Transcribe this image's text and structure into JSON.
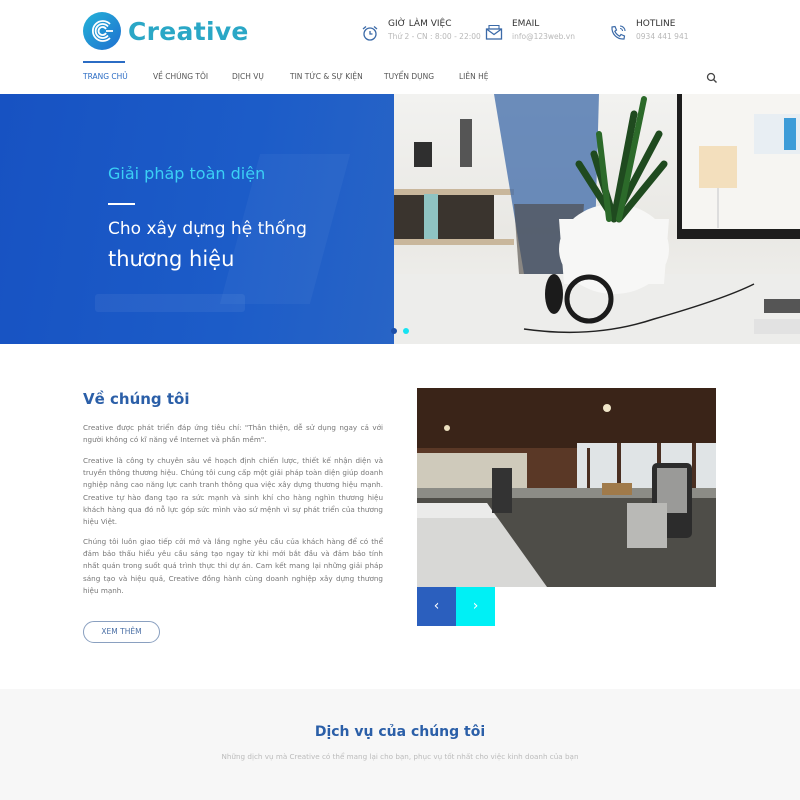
{
  "brand": {
    "name": "Creative",
    "colors": {
      "primary": "#1c5cc8",
      "accent": "#00f0f5",
      "title": "#2b5fa8",
      "logo": "#2aa7c6"
    }
  },
  "header": {
    "working_hours": {
      "icon": "alarm-clock-icon",
      "label": "GIỜ LÀM VIỆC",
      "value": "Thứ 2 - CN : 8:00 - 22:00"
    },
    "email": {
      "icon": "envelope-icon",
      "label": "EMAIL",
      "value": "info@123web.vn"
    },
    "hotline": {
      "icon": "phone-icon",
      "label": "HOTLINE",
      "value": "0934 441 941"
    }
  },
  "nav": {
    "items": [
      {
        "label": "Trang chủ",
        "active": true
      },
      {
        "label": "Về chúng tôi",
        "active": false
      },
      {
        "label": "Dịch vụ",
        "active": false
      },
      {
        "label": "Tin tức & sự kiện",
        "active": false
      },
      {
        "label": "Tuyển dụng",
        "active": false
      },
      {
        "label": "Liên hệ",
        "active": false
      }
    ],
    "search_icon": "search-icon"
  },
  "hero": {
    "subtitle": "Giải pháp toàn diện",
    "line1": "Cho xây dựng hệ thống",
    "line2": "thương hiệu",
    "slides_total": 2,
    "active_slide": 2
  },
  "about": {
    "title": "Về chúng tôi",
    "paragraphs": [
      "Creative được phát triển đáp ứng tiêu chí: \"Thân thiện, dễ sử dụng ngay cả với người không có kĩ năng về Internet và phần mềm\".",
      "Creative là công ty chuyên sâu về hoạch định chiến lược, thiết kế nhận diện và truyền thông thương hiệu. Chúng tôi cung cấp một giải pháp toàn diện giúp doanh nghiệp nâng cao năng lực canh tranh thông qua việc xây dựng thương hiệu mạnh. Creative tự hào đang tạo ra sức mạnh và sinh khí cho hàng nghìn thương hiệu khách hàng qua đó nỗ lực góp sức mình vào sứ mệnh vì sự phát triển của thương hiệu Việt.",
      "Chúng tôi luôn giao tiếp cởi mở và lắng nghe yêu cầu của khách hàng để có thể đảm bảo thấu hiểu yêu cầu sáng tạo ngay từ khi mới bắt đầu và đảm bảo tính nhất quán trong suốt quá trình thực thi dự án. Cam kết mang lại những giải pháp sáng tạo và hiệu quả, Creative đồng hành cùng doanh nghiệp xây dựng thương hiệu mạnh."
    ],
    "more_button": "XEM THÊM",
    "prev_arrow": "‹",
    "next_arrow": "›"
  },
  "services": {
    "title": "Dịch vụ của chúng tôi",
    "subtitle": "Những dịch vụ mà Creative có thể mang lại cho bạn, phục vụ tốt nhất cho việc kinh doanh của bạn"
  }
}
